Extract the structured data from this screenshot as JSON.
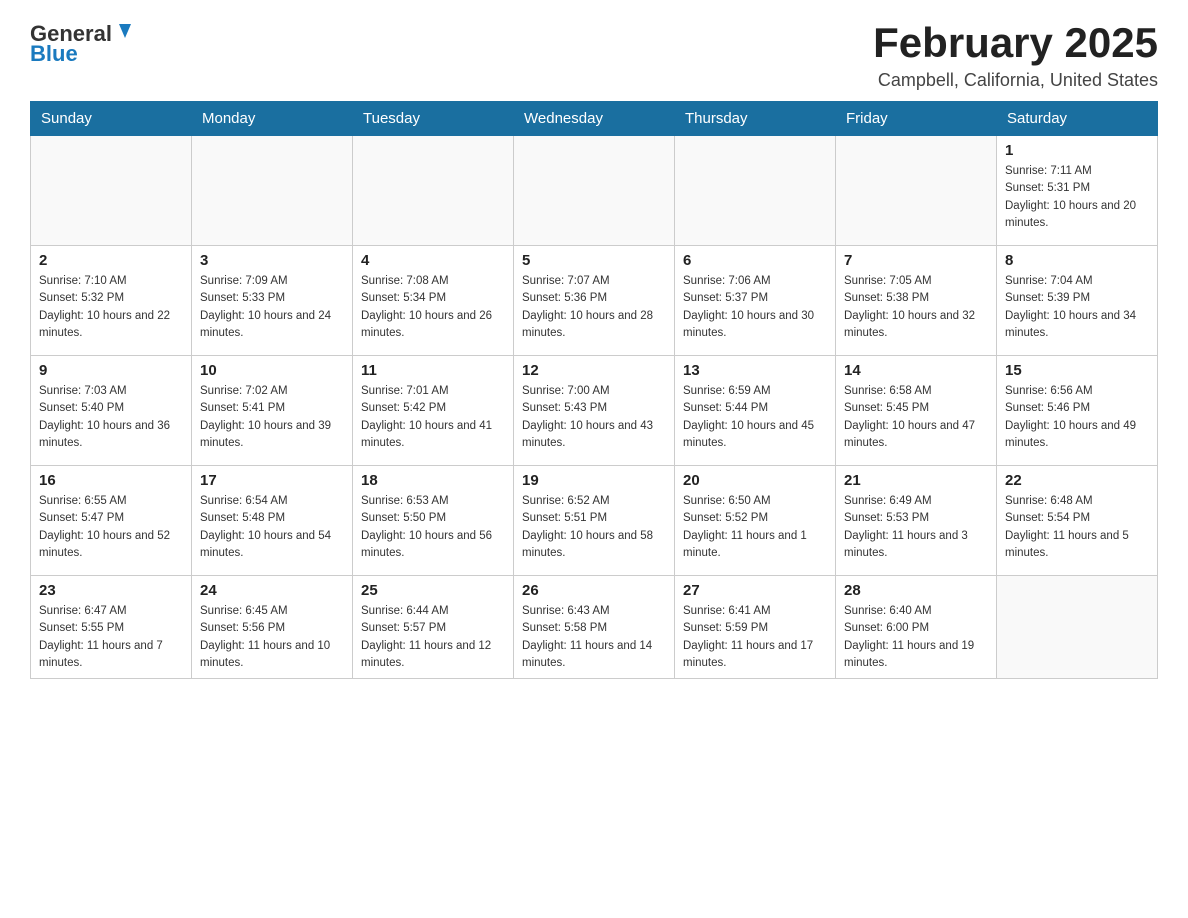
{
  "header": {
    "logo_general": "General",
    "logo_blue": "Blue",
    "month_title": "February 2025",
    "location": "Campbell, California, United States"
  },
  "days_of_week": [
    "Sunday",
    "Monday",
    "Tuesday",
    "Wednesday",
    "Thursday",
    "Friday",
    "Saturday"
  ],
  "weeks": [
    {
      "days": [
        {
          "num": "",
          "info": ""
        },
        {
          "num": "",
          "info": ""
        },
        {
          "num": "",
          "info": ""
        },
        {
          "num": "",
          "info": ""
        },
        {
          "num": "",
          "info": ""
        },
        {
          "num": "",
          "info": ""
        },
        {
          "num": "1",
          "info": "Sunrise: 7:11 AM\nSunset: 5:31 PM\nDaylight: 10 hours and 20 minutes."
        }
      ]
    },
    {
      "days": [
        {
          "num": "2",
          "info": "Sunrise: 7:10 AM\nSunset: 5:32 PM\nDaylight: 10 hours and 22 minutes."
        },
        {
          "num": "3",
          "info": "Sunrise: 7:09 AM\nSunset: 5:33 PM\nDaylight: 10 hours and 24 minutes."
        },
        {
          "num": "4",
          "info": "Sunrise: 7:08 AM\nSunset: 5:34 PM\nDaylight: 10 hours and 26 minutes."
        },
        {
          "num": "5",
          "info": "Sunrise: 7:07 AM\nSunset: 5:36 PM\nDaylight: 10 hours and 28 minutes."
        },
        {
          "num": "6",
          "info": "Sunrise: 7:06 AM\nSunset: 5:37 PM\nDaylight: 10 hours and 30 minutes."
        },
        {
          "num": "7",
          "info": "Sunrise: 7:05 AM\nSunset: 5:38 PM\nDaylight: 10 hours and 32 minutes."
        },
        {
          "num": "8",
          "info": "Sunrise: 7:04 AM\nSunset: 5:39 PM\nDaylight: 10 hours and 34 minutes."
        }
      ]
    },
    {
      "days": [
        {
          "num": "9",
          "info": "Sunrise: 7:03 AM\nSunset: 5:40 PM\nDaylight: 10 hours and 36 minutes."
        },
        {
          "num": "10",
          "info": "Sunrise: 7:02 AM\nSunset: 5:41 PM\nDaylight: 10 hours and 39 minutes."
        },
        {
          "num": "11",
          "info": "Sunrise: 7:01 AM\nSunset: 5:42 PM\nDaylight: 10 hours and 41 minutes."
        },
        {
          "num": "12",
          "info": "Sunrise: 7:00 AM\nSunset: 5:43 PM\nDaylight: 10 hours and 43 minutes."
        },
        {
          "num": "13",
          "info": "Sunrise: 6:59 AM\nSunset: 5:44 PM\nDaylight: 10 hours and 45 minutes."
        },
        {
          "num": "14",
          "info": "Sunrise: 6:58 AM\nSunset: 5:45 PM\nDaylight: 10 hours and 47 minutes."
        },
        {
          "num": "15",
          "info": "Sunrise: 6:56 AM\nSunset: 5:46 PM\nDaylight: 10 hours and 49 minutes."
        }
      ]
    },
    {
      "days": [
        {
          "num": "16",
          "info": "Sunrise: 6:55 AM\nSunset: 5:47 PM\nDaylight: 10 hours and 52 minutes."
        },
        {
          "num": "17",
          "info": "Sunrise: 6:54 AM\nSunset: 5:48 PM\nDaylight: 10 hours and 54 minutes."
        },
        {
          "num": "18",
          "info": "Sunrise: 6:53 AM\nSunset: 5:50 PM\nDaylight: 10 hours and 56 minutes."
        },
        {
          "num": "19",
          "info": "Sunrise: 6:52 AM\nSunset: 5:51 PM\nDaylight: 10 hours and 58 minutes."
        },
        {
          "num": "20",
          "info": "Sunrise: 6:50 AM\nSunset: 5:52 PM\nDaylight: 11 hours and 1 minute."
        },
        {
          "num": "21",
          "info": "Sunrise: 6:49 AM\nSunset: 5:53 PM\nDaylight: 11 hours and 3 minutes."
        },
        {
          "num": "22",
          "info": "Sunrise: 6:48 AM\nSunset: 5:54 PM\nDaylight: 11 hours and 5 minutes."
        }
      ]
    },
    {
      "days": [
        {
          "num": "23",
          "info": "Sunrise: 6:47 AM\nSunset: 5:55 PM\nDaylight: 11 hours and 7 minutes."
        },
        {
          "num": "24",
          "info": "Sunrise: 6:45 AM\nSunset: 5:56 PM\nDaylight: 11 hours and 10 minutes."
        },
        {
          "num": "25",
          "info": "Sunrise: 6:44 AM\nSunset: 5:57 PM\nDaylight: 11 hours and 12 minutes."
        },
        {
          "num": "26",
          "info": "Sunrise: 6:43 AM\nSunset: 5:58 PM\nDaylight: 11 hours and 14 minutes."
        },
        {
          "num": "27",
          "info": "Sunrise: 6:41 AM\nSunset: 5:59 PM\nDaylight: 11 hours and 17 minutes."
        },
        {
          "num": "28",
          "info": "Sunrise: 6:40 AM\nSunset: 6:00 PM\nDaylight: 11 hours and 19 minutes."
        },
        {
          "num": "",
          "info": ""
        }
      ]
    }
  ]
}
